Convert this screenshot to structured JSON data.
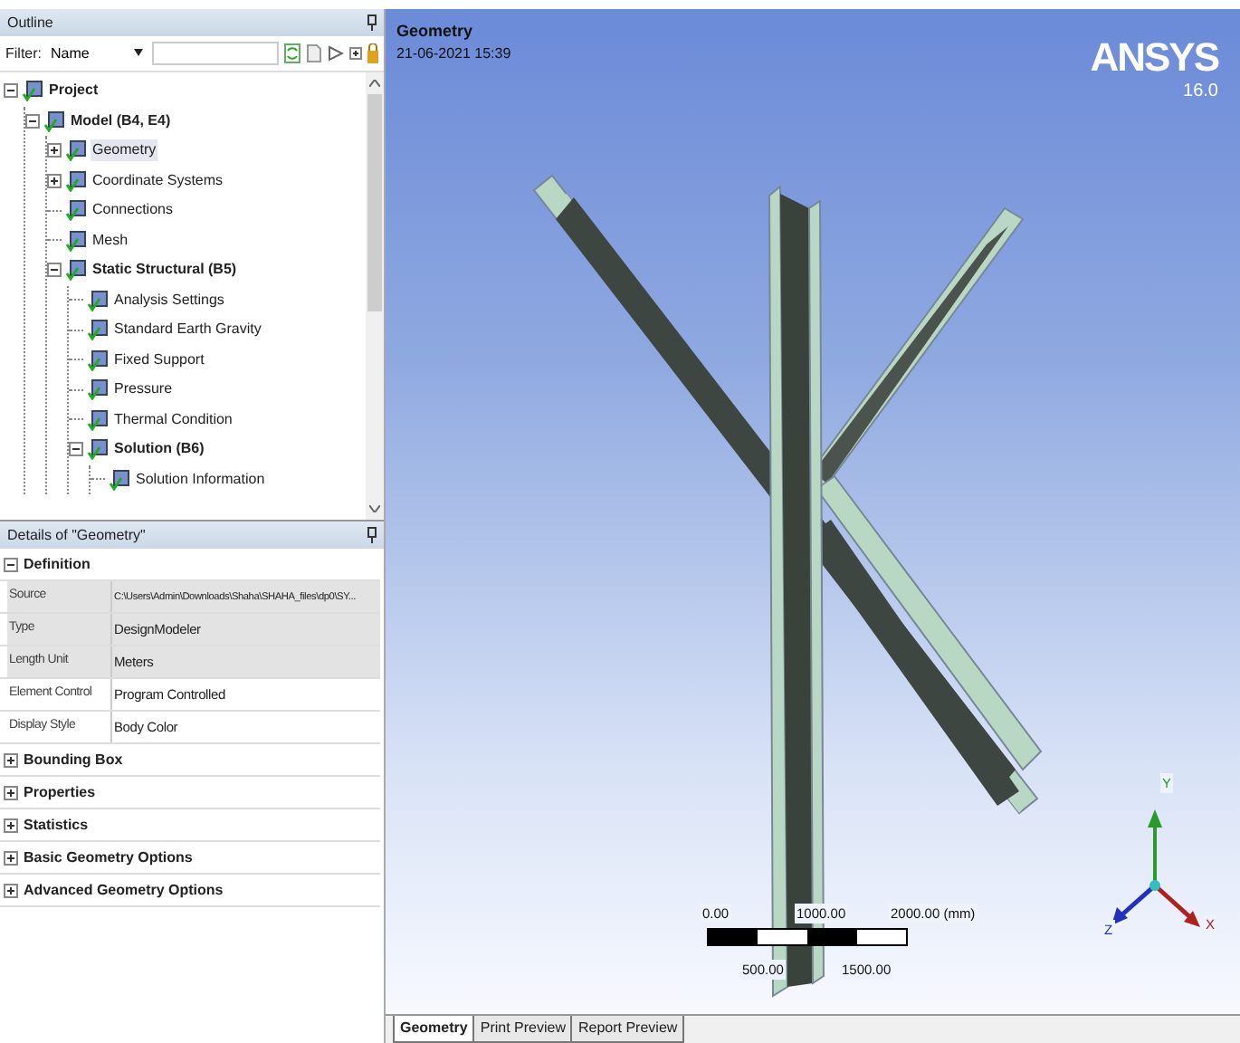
{
  "outline": {
    "title": "Outline",
    "filter": {
      "label": "Filter:",
      "value": "Name"
    },
    "tree": [
      {
        "label": "Project",
        "bold": true,
        "expanded": true,
        "selected": false,
        "children": [
          {
            "label": "Model (B4, E4)",
            "bold": true,
            "expanded": true,
            "selected": false,
            "children": [
              {
                "label": "Geometry",
                "bold": false,
                "expanded": false,
                "selected": true
              },
              {
                "label": "Coordinate Systems",
                "bold": false,
                "expanded": false,
                "selected": false
              },
              {
                "label": "Connections",
                "bold": false,
                "selected": false
              },
              {
                "label": "Mesh",
                "bold": false,
                "selected": false
              },
              {
                "label": "Static Structural (B5)",
                "bold": true,
                "expanded": true,
                "selected": false,
                "children": [
                  {
                    "label": "Analysis Settings",
                    "bold": false,
                    "selected": false
                  },
                  {
                    "label": "Standard Earth Gravity",
                    "bold": false,
                    "selected": false
                  },
                  {
                    "label": "Fixed Support",
                    "bold": false,
                    "selected": false
                  },
                  {
                    "label": "Pressure",
                    "bold": false,
                    "selected": false
                  },
                  {
                    "label": "Thermal Condition",
                    "bold": false,
                    "selected": false
                  },
                  {
                    "label": "Solution (B6)",
                    "bold": true,
                    "expanded": true,
                    "selected": false,
                    "children": [
                      {
                        "label": "Solution Information",
                        "bold": false,
                        "selected": false
                      }
                    ]
                  }
                ]
              }
            ]
          }
        ]
      }
    ]
  },
  "details": {
    "title": "Details of \"Geometry\"",
    "sections": [
      {
        "title": "Definition",
        "expanded": true,
        "rows": [
          {
            "label": "Source",
            "value": "C:\\Users\\Admin\\Downloads\\Shaha\\SHAHA_files\\dp0\\SY...",
            "readonly": true
          },
          {
            "label": "Type",
            "value": "DesignModeler",
            "readonly": true
          },
          {
            "label": "Length Unit",
            "value": "Meters",
            "readonly": true
          },
          {
            "label": "Element Control",
            "value": "Program Controlled",
            "readonly": false
          },
          {
            "label": "Display Style",
            "value": "Body Color",
            "readonly": false
          }
        ]
      },
      {
        "title": "Bounding Box",
        "expanded": false
      },
      {
        "title": "Properties",
        "expanded": false
      },
      {
        "title": "Statistics",
        "expanded": false
      },
      {
        "title": "Basic Geometry Options",
        "expanded": false
      },
      {
        "title": "Advanced Geometry Options",
        "expanded": false
      }
    ]
  },
  "viewport": {
    "title": "Geometry",
    "timestamp": "21-06-2021 15:39",
    "logo": "ANSYS",
    "version": "16.0",
    "scale_bar": {
      "top_labels": [
        "0.00",
        "1000.00",
        "2000.00 (mm)"
      ],
      "bottom_labels": [
        "500.00",
        "1500.00"
      ]
    },
    "axes": {
      "y": "Y",
      "z": "Z",
      "x": "X"
    }
  },
  "tabs": [
    {
      "label": "Geometry",
      "selected": true
    },
    {
      "label": "Print Preview",
      "selected": false
    },
    {
      "label": "Report Preview",
      "selected": false
    }
  ]
}
